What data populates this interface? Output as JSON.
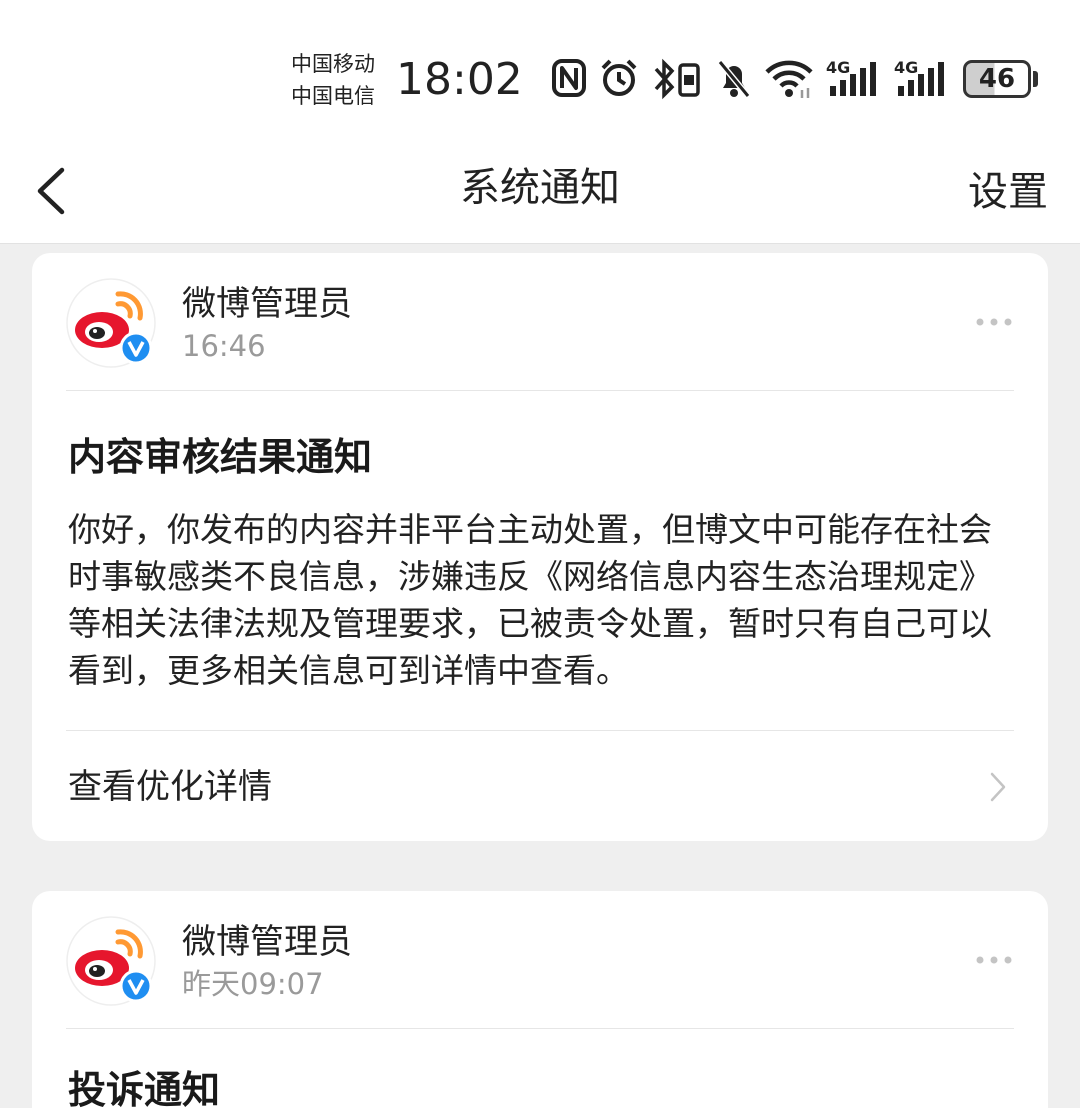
{
  "status_bar": {
    "carrier_1": "中国移动",
    "carrier_2": "中国电信",
    "time": "18:02",
    "battery_level": "46",
    "network_1": "4G",
    "network_2": "4G",
    "icons": [
      "nfc-icon",
      "alarm-icon",
      "bluetooth-icon",
      "mute-icon",
      "wifi-icon",
      "signal-icon",
      "signal-icon",
      "battery-icon"
    ]
  },
  "nav": {
    "title": "系统通知",
    "settings_label": "设置"
  },
  "notifications": [
    {
      "sender": "微博管理员",
      "time": "16:46",
      "title": "内容审核结果通知",
      "body": "你好，你发布的内容并非平台主动处置，但博文中可能存在社会时事敏感类不良信息，涉嫌违反《网络信息内容生态治理规定》等相关法律法规及管理要求，已被责令处置，暂时只有自己可以看到，更多相关信息可到详情中查看。",
      "action_label": "查看优化详情"
    },
    {
      "sender": "微博管理员",
      "time": "昨天09:07",
      "title": "投诉通知"
    }
  ],
  "colors": {
    "background": "#efefef",
    "card": "#ffffff",
    "weibo_red": "#e6162d",
    "weibo_orange": "#ff9933",
    "verified_blue": "#1f8ef1",
    "muted_text": "#9a9a9a"
  }
}
